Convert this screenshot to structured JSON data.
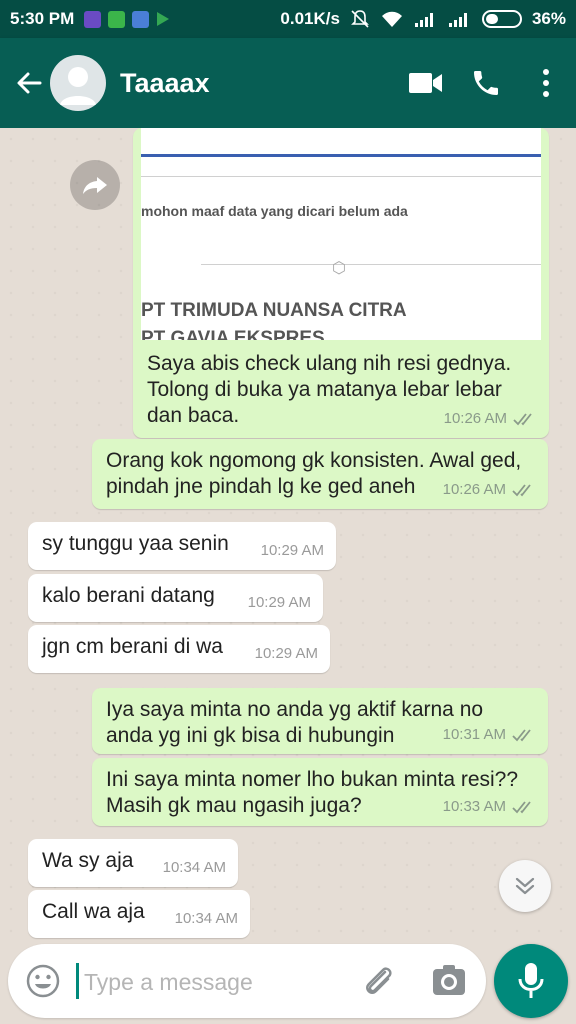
{
  "status_bar": {
    "time": "5:30 PM",
    "network_speed": "0.01K/s",
    "battery_percent": "36%",
    "battery_level": 0.36
  },
  "header": {
    "contact_name": "Taaaax"
  },
  "shared_image": {
    "line_1": "mohon maaf data yang dicari belum ada",
    "line_2": "PT TRIMUDA NUANSA CITRA",
    "line_3": "PT GAVIA EKSPRES"
  },
  "messages": [
    {
      "direction": "outgoing",
      "text_lines": [
        "Saya abis check ulang nih resi gednya.",
        "Tolong di buka ya matanya lebar lebar",
        "dan baca."
      ],
      "time": "10:26 AM",
      "read": true
    },
    {
      "direction": "outgoing",
      "text_lines": [
        "Orang kok ngomong gk konsisten. Awal ged,",
        "pindah jne pindah lg ke ged aneh"
      ],
      "time": "10:26 AM",
      "read": true
    },
    {
      "direction": "incoming",
      "text_lines": [
        "sy tunggu yaa senin"
      ],
      "time": "10:29 AM"
    },
    {
      "direction": "incoming",
      "text_lines": [
        "kalo berani datang"
      ],
      "time": "10:29 AM"
    },
    {
      "direction": "incoming",
      "text_lines": [
        "jgn cm berani di wa"
      ],
      "time": "10:29 AM"
    },
    {
      "direction": "outgoing",
      "text_lines": [
        "Iya saya minta no anda yg aktif karna no",
        "anda yg ini gk bisa di hubungin"
      ],
      "time": "10:31 AM",
      "read": true
    },
    {
      "direction": "outgoing",
      "text_lines": [
        "Ini saya minta nomer lho bukan minta resi??",
        "Masih gk mau ngasih juga?"
      ],
      "time": "10:33 AM",
      "read": true
    },
    {
      "direction": "incoming",
      "text_lines": [
        "Wa sy aja"
      ],
      "time": "10:34 AM"
    },
    {
      "direction": "incoming",
      "text_lines": [
        "Call wa aja"
      ],
      "time": "10:34 AM"
    }
  ],
  "composer": {
    "placeholder": "Type a message",
    "value": ""
  },
  "colors": {
    "header": "#075e54",
    "status_bar": "#054d44",
    "outgoing_bubble": "#dcf8c6",
    "incoming_bubble": "#ffffff",
    "accent": "#00897b",
    "read_ticks": "#8a9a8a"
  },
  "icons": {
    "back": "arrow-left-icon",
    "video_call": "video-camera-icon",
    "voice_call": "phone-icon",
    "menu": "more-vertical-icon",
    "forward": "forward-icon",
    "scroll_down": "double-chevron-down-icon",
    "emoji": "emoji-icon",
    "attach": "paperclip-icon",
    "camera": "camera-icon",
    "mic": "microphone-icon"
  }
}
